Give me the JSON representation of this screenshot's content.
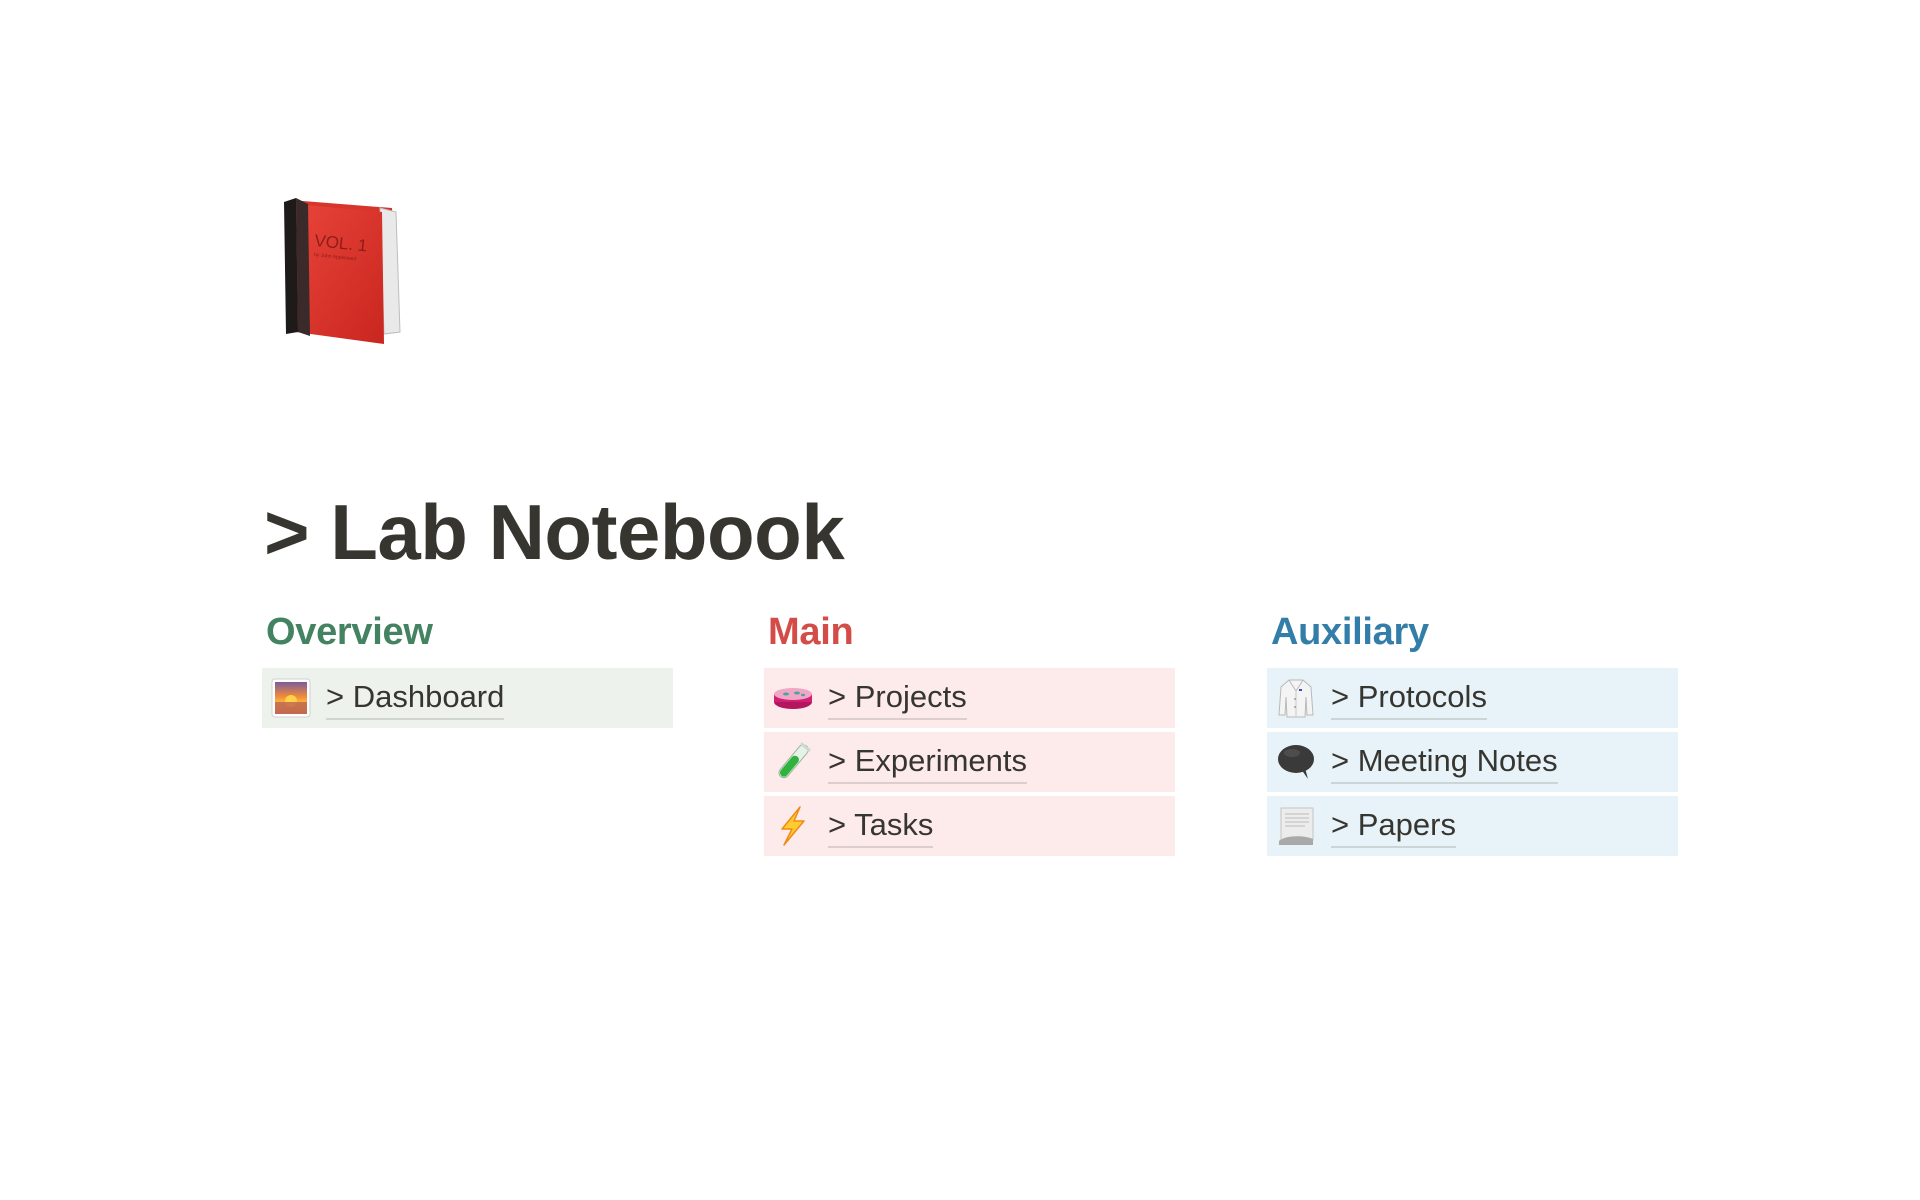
{
  "page": {
    "icon": "red-book-icon",
    "icon_text": {
      "vol": "VOL. 1",
      "author": "by John Appleseed"
    },
    "title": "> Lab Notebook"
  },
  "colors": {
    "text": "#37352f",
    "overview_heading": "#448361",
    "overview_bg": "#edf3ec",
    "main_heading": "#d44c47",
    "main_bg": "#fdebec",
    "aux_heading": "#337ea9",
    "aux_bg": "#e7f3f8"
  },
  "columns": [
    {
      "heading": "Overview",
      "items": [
        {
          "icon": "sunrise-icon",
          "label": "> Dashboard"
        }
      ]
    },
    {
      "heading": "Main",
      "items": [
        {
          "icon": "petri-dish-icon",
          "label": "> Projects"
        },
        {
          "icon": "test-tube-icon",
          "label": "> Experiments"
        },
        {
          "icon": "lightning-icon",
          "label": "> Tasks"
        }
      ]
    },
    {
      "heading": "Auxiliary",
      "items": [
        {
          "icon": "lab-coat-icon",
          "label": "> Protocols"
        },
        {
          "icon": "speech-balloon-icon",
          "label": "> Meeting Notes"
        },
        {
          "icon": "page-curl-icon",
          "label": "> Papers"
        }
      ]
    }
  ]
}
